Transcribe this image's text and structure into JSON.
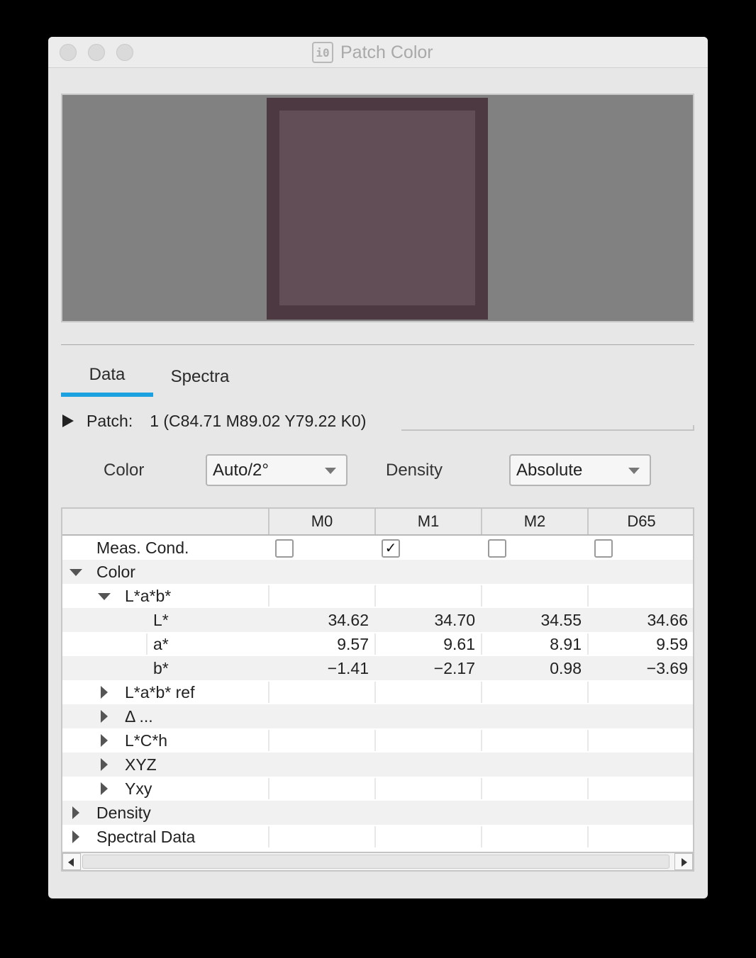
{
  "window": {
    "title": "Patch Color",
    "app_icon_glyph": "i0"
  },
  "preview": {
    "background_color": "#818181",
    "patch_border_color": "#4d3942",
    "patch_color": "#614e57"
  },
  "tabs": [
    {
      "label": "Data",
      "active": true
    },
    {
      "label": "Spectra",
      "active": false
    }
  ],
  "patch": {
    "label": "Patch:",
    "value": "1 (C84.71 M89.02 Y79.22 K0)"
  },
  "controls": {
    "color_label": "Color",
    "color_value": "Auto/2°",
    "density_label": "Density",
    "density_value": "Absolute"
  },
  "table": {
    "columns": [
      "M0",
      "M1",
      "M2",
      "D65"
    ],
    "meas_cond_label": "Meas. Cond.",
    "meas_cond_checked": [
      false,
      true,
      false,
      false
    ],
    "check_glyph": "✓",
    "groups": {
      "color": "Color",
      "lab": "L*a*b*",
      "lab_ref": "L*a*b* ref",
      "delta": "Δ ...",
      "lch": "L*C*h",
      "xyz": "XYZ",
      "yxy": "Yxy",
      "density": "Density",
      "spectral": "Spectral Data"
    },
    "rows": [
      {
        "label": "L*",
        "values": [
          "34.62",
          "34.70",
          "34.55",
          "34.66"
        ]
      },
      {
        "label": "a*",
        "values": [
          "9.57",
          "9.61",
          "8.91",
          "9.59"
        ]
      },
      {
        "label": "b*",
        "values": [
          "−1.41",
          "−2.17",
          "0.98",
          "−3.69"
        ]
      }
    ]
  },
  "accent_color": "#1ba0e0"
}
